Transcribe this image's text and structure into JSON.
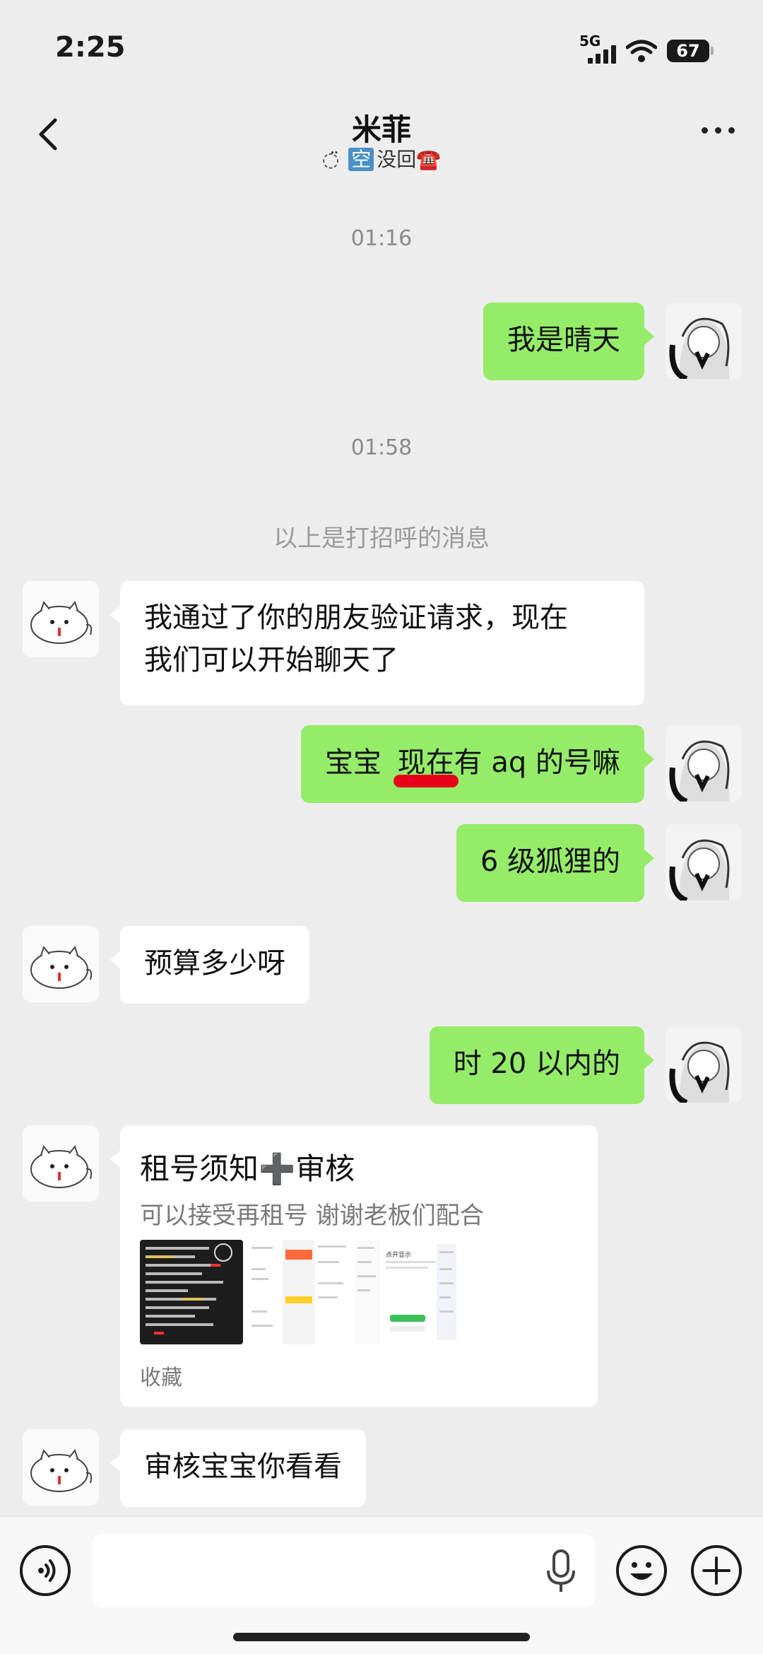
{
  "status_bar": {
    "time": "2:25",
    "network": "5G",
    "battery": "67"
  },
  "header": {
    "title": "米菲",
    "subtitle_prefix": "◌̈",
    "subtitle_boxed": "空",
    "subtitle_text": "没回☎️",
    "back_icon": "chevron-left-icon",
    "more_icon": "more-dots-icon"
  },
  "chat": {
    "timestamps": [
      "01:16",
      "01:58"
    ],
    "system_notice": "以上是打招呼的消息",
    "messages": [
      {
        "side": "out",
        "text": "我是晴天"
      },
      {
        "side": "in",
        "line1": "我通过了你的朋友验证请求，现在",
        "line2": "我们可以开始聊天了"
      },
      {
        "side": "out",
        "part1": "宝宝",
        "part2": "现在",
        "part3": "有 aq 的号嘛"
      },
      {
        "side": "out",
        "text": "6 级狐狸的"
      },
      {
        "side": "in",
        "text": "预算多少呀"
      },
      {
        "side": "out",
        "text": "时 20 以内的"
      },
      {
        "side": "in",
        "text": "审核宝宝你看看"
      }
    ],
    "card": {
      "title": "租号须知➕审核",
      "description": "可以接受再租号 谢谢老板们配合",
      "footer": "收藏",
      "thumb_labels": [
        "点开显示"
      ]
    }
  },
  "input_bar": {
    "placeholder": "",
    "voice_icon": "voice-icon",
    "mic_icon": "mic-icon",
    "emoji_icon": "emoji-icon",
    "plus_icon": "plus-icon"
  },
  "colors": {
    "outgoing_bubble": "#95ec69",
    "incoming_bubble": "#ffffff",
    "background": "#ededed",
    "highlight": "#e8001a"
  }
}
